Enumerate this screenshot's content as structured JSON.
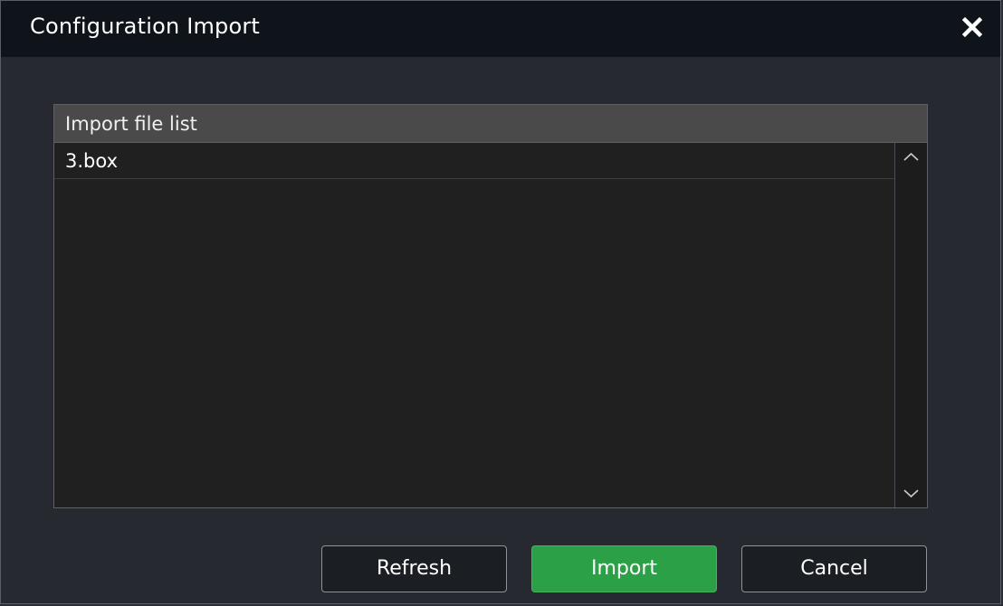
{
  "dialog": {
    "title": "Configuration Import",
    "close_icon": "close-icon"
  },
  "file_list": {
    "header": "Import file list",
    "items": [
      {
        "name": "3.box"
      }
    ],
    "scroll_up_icon": "chevron-up-icon",
    "scroll_down_icon": "chevron-down-icon"
  },
  "buttons": {
    "refresh_label": "Refresh",
    "import_label": "Import",
    "cancel_label": "Cancel"
  },
  "colors": {
    "titlebar_bg": "#0f141a",
    "dialog_bg": "#262a30",
    "list_header_bg": "#4a4a4a",
    "list_bg": "#202020",
    "primary_button": "#2ca047",
    "text": "#ffffff"
  }
}
